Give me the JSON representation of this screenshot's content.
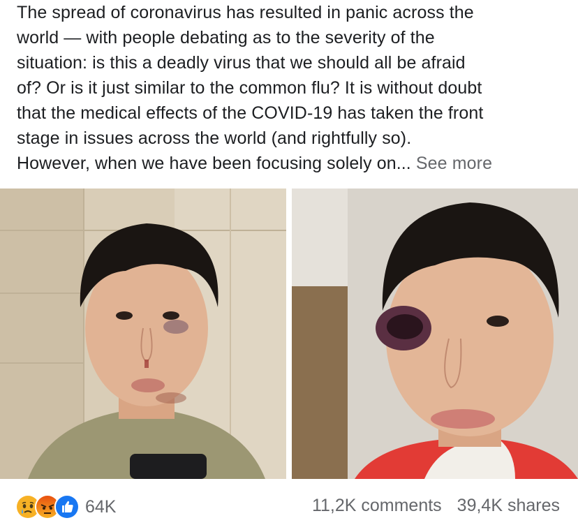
{
  "post": {
    "text_lines": [
      "The spread of coronavirus has resulted in panic across the",
      "world — with people debating as to the severity of the",
      "situation: is this a deadly virus that we should all be afraid",
      "of? Or is it just similar to the common flu? It is without doubt",
      "that the medical effects of the COVID-19 has taken the front",
      "stage in issues across the world (and rightfully so).",
      "However, when we have been focusing solely on..."
    ],
    "see_more": "See more"
  },
  "photos": [
    {
      "name": "photo-selfie-injured-face-1"
    },
    {
      "name": "photo-selfie-injured-face-2"
    }
  ],
  "reactions": {
    "icons": [
      "sad-reaction-icon",
      "angry-reaction-icon",
      "like-reaction-icon"
    ],
    "count": "64K"
  },
  "stats": {
    "comments": "11,2K comments",
    "shares": "39,4K shares"
  },
  "colors": {
    "text": "#1c1e21",
    "secondary": "#65676b",
    "like_blue": "#1877f2",
    "angry_orange": "#e9710f",
    "sad_yellow": "#f7b125"
  }
}
